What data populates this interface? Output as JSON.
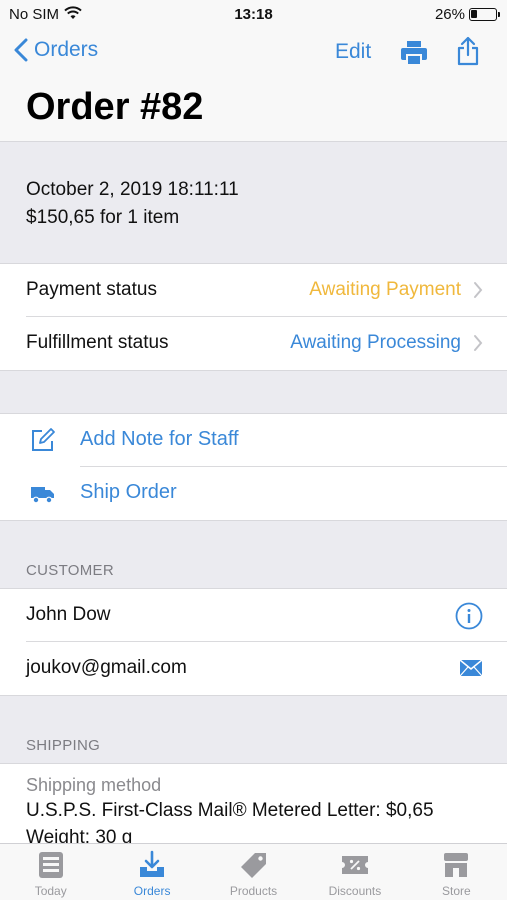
{
  "status_bar": {
    "carrier": "No SIM",
    "time": "13:18",
    "battery": "26%"
  },
  "nav": {
    "back_label": "Orders",
    "edit_label": "Edit",
    "title": "Order #82"
  },
  "summary": {
    "date": "October 2, 2019 18:11:11",
    "total": "$150,65 for 1 item"
  },
  "statuses": [
    {
      "label": "Payment status",
      "value": "Awaiting Payment",
      "color": "#f0b83c"
    },
    {
      "label": "Fulfillment status",
      "value": "Awaiting Processing",
      "color": "#3a88d8"
    }
  ],
  "actions": [
    {
      "label": "Add Note for Staff",
      "icon": "edit-icon"
    },
    {
      "label": "Ship Order",
      "icon": "truck-icon"
    }
  ],
  "customer": {
    "header": "CUSTOMER",
    "name": "John Dow",
    "email": "joukov@gmail.com"
  },
  "shipping": {
    "header": "SHIPPING",
    "method_label": "Shipping method",
    "method_value": "U.S.P.S. First-Class Mail® Metered Letter: $0,65",
    "weight": "Weight: 30 g"
  },
  "tabs": [
    {
      "label": "Today",
      "icon": "today-icon",
      "active": false
    },
    {
      "label": "Orders",
      "icon": "orders-icon",
      "active": true
    },
    {
      "label": "Products",
      "icon": "tag-icon",
      "active": false
    },
    {
      "label": "Discounts",
      "icon": "discount-icon",
      "active": false
    },
    {
      "label": "Store",
      "icon": "store-icon",
      "active": false
    }
  ],
  "colors": {
    "accent": "#3a88d8",
    "awaiting_payment": "#f0b83c"
  }
}
